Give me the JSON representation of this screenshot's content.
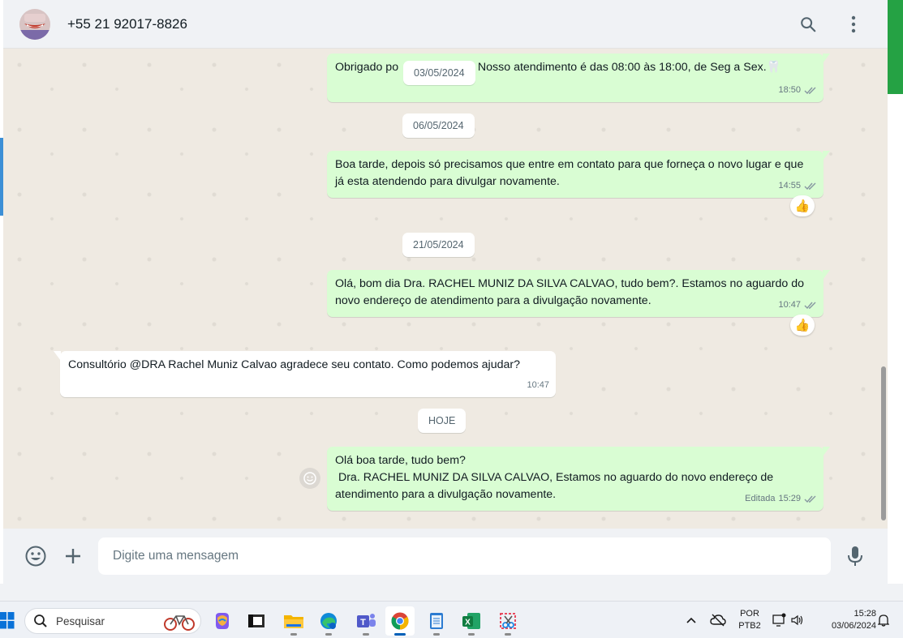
{
  "header": {
    "contact_name": "+55 21 92017-8826"
  },
  "messages": {
    "chips": {
      "d1": "03/05/2024",
      "d2": "06/05/2024",
      "d3": "21/05/2024",
      "today": "HOJE"
    },
    "m1": {
      "text_a": "Obrigado po",
      "text_b": "r. Nosso atendimento é das 08:00 às 18:00, de Seg a Sex.🦷",
      "time": "18:50"
    },
    "m2": {
      "text": "Boa tarde, depois só precisamos que entre em contato para que forneça o novo lugar e que já esta atendendo para divulgar novamente.",
      "time": "14:55",
      "reaction": "👍"
    },
    "m3": {
      "text": "Olá, bom dia Dra. RACHEL MUNIZ DA SILVA CALVAO, tudo bem?. Estamos no aguardo do novo endereço de atendimento para a divulgação novamente.",
      "time": "10:47",
      "reaction": "👍"
    },
    "m4": {
      "text": "Consultório @DRA Rachel Muniz Calvao agradece seu contato. Como podemos ajudar?",
      "time": "10:47"
    },
    "m5": {
      "line1": "Olá boa tarde, tudo bem?",
      "line2": " Dra. RACHEL MUNIZ DA SILVA CALVAO, Estamos no aguardo do novo endereço de atendimento para a divulgação novamente.",
      "edited": "Editada",
      "time": "15:29"
    }
  },
  "composer": {
    "placeholder": "Digite uma mensagem"
  },
  "taskbar": {
    "search_label": "Pesquisar",
    "language_line1": "POR",
    "language_line2": "PTB2",
    "time": "15:28",
    "date": "03/06/2024",
    "apps": [
      "copilot-icon",
      "terminal-icon",
      "file-explorer-icon",
      "edge-icon",
      "teams-icon",
      "chrome-icon",
      "notepad-icon",
      "excel-icon",
      "snipping-tool-icon"
    ]
  },
  "colors": {
    "outgoing_bubble": "#d9fdd3",
    "incoming_bubble": "#ffffff",
    "chat_background": "#efeae2",
    "read_ticks": "#8696a0",
    "accent_green": "#25a244"
  }
}
